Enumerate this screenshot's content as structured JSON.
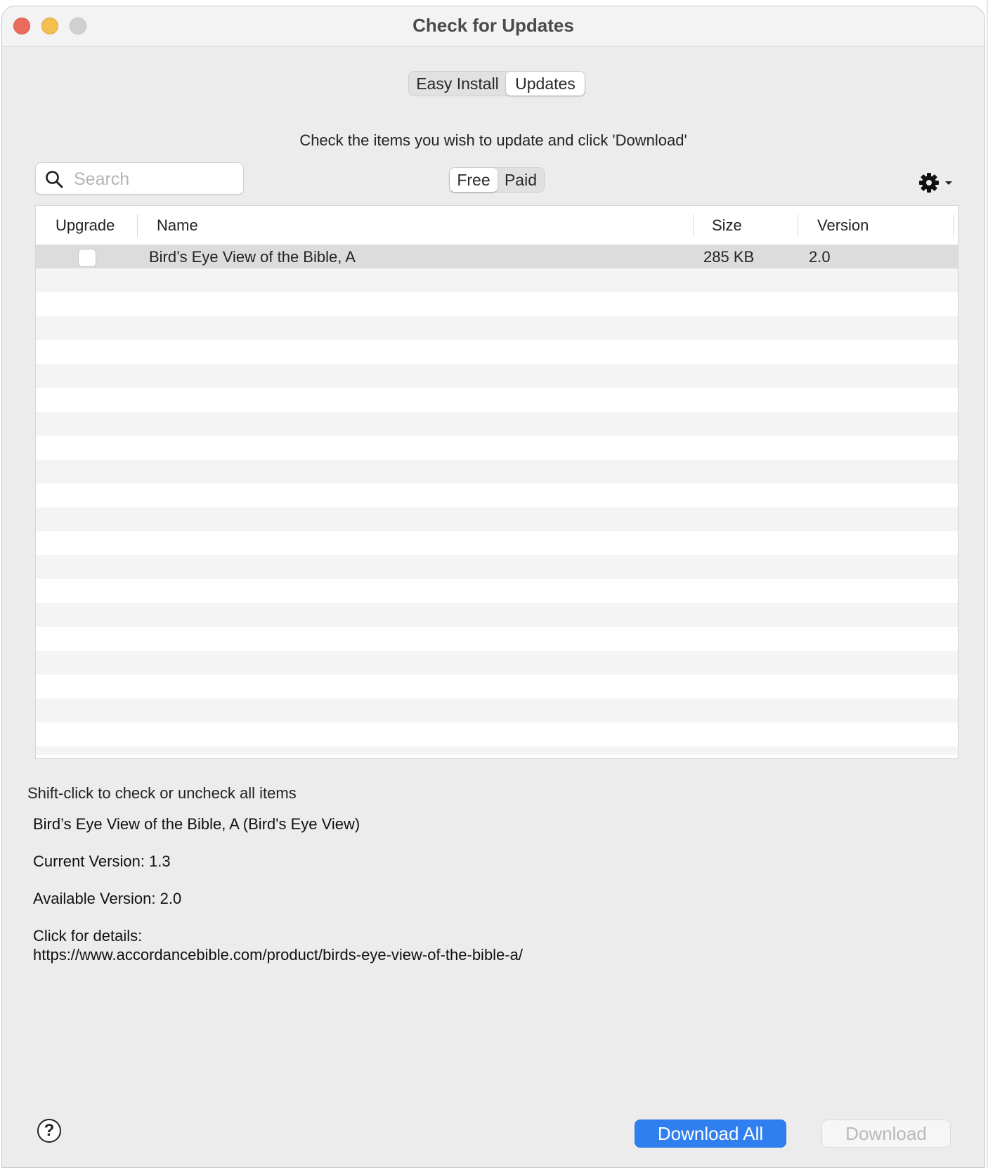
{
  "window": {
    "title": "Check for Updates"
  },
  "top_tabs": [
    {
      "label": "Easy Install",
      "selected": false
    },
    {
      "label": "Updates",
      "selected": true
    }
  ],
  "instructions": "Check the items you wish to update and click 'Download'",
  "search": {
    "placeholder": "Search",
    "value": ""
  },
  "filter_tabs": [
    {
      "label": "Free",
      "selected": true
    },
    {
      "label": "Paid",
      "selected": false
    }
  ],
  "toolbar": {
    "gear_icon": "gear-icon",
    "menu_icon": "chevron-down-icon"
  },
  "table": {
    "columns": [
      "Upgrade",
      "Name",
      "Size",
      "Version"
    ],
    "rows": [
      {
        "checked": false,
        "name": "Bird’s Eye View of the Bible, A",
        "size": "285 KB",
        "version": "2.0"
      }
    ]
  },
  "hint": "Shift-click to check or uncheck all items",
  "details": {
    "title": "Bird’s Eye View of the Bible, A (Bird's Eye View)",
    "current_version": "Current Version: 1.3",
    "available_version": "Available Version: 2.0",
    "click_for_details": "Click for details:",
    "url": "https://www.accordancebible.com/product/birds-eye-view-of-the-bible-a/"
  },
  "buttons": {
    "help": "?",
    "download_all": "Download All",
    "download": "Download"
  },
  "colors": {
    "accent": "#2f7ff0",
    "close": "#ed6a5e",
    "minimize": "#f5bf4f",
    "zoom_inactive": "#d0d0d0"
  }
}
